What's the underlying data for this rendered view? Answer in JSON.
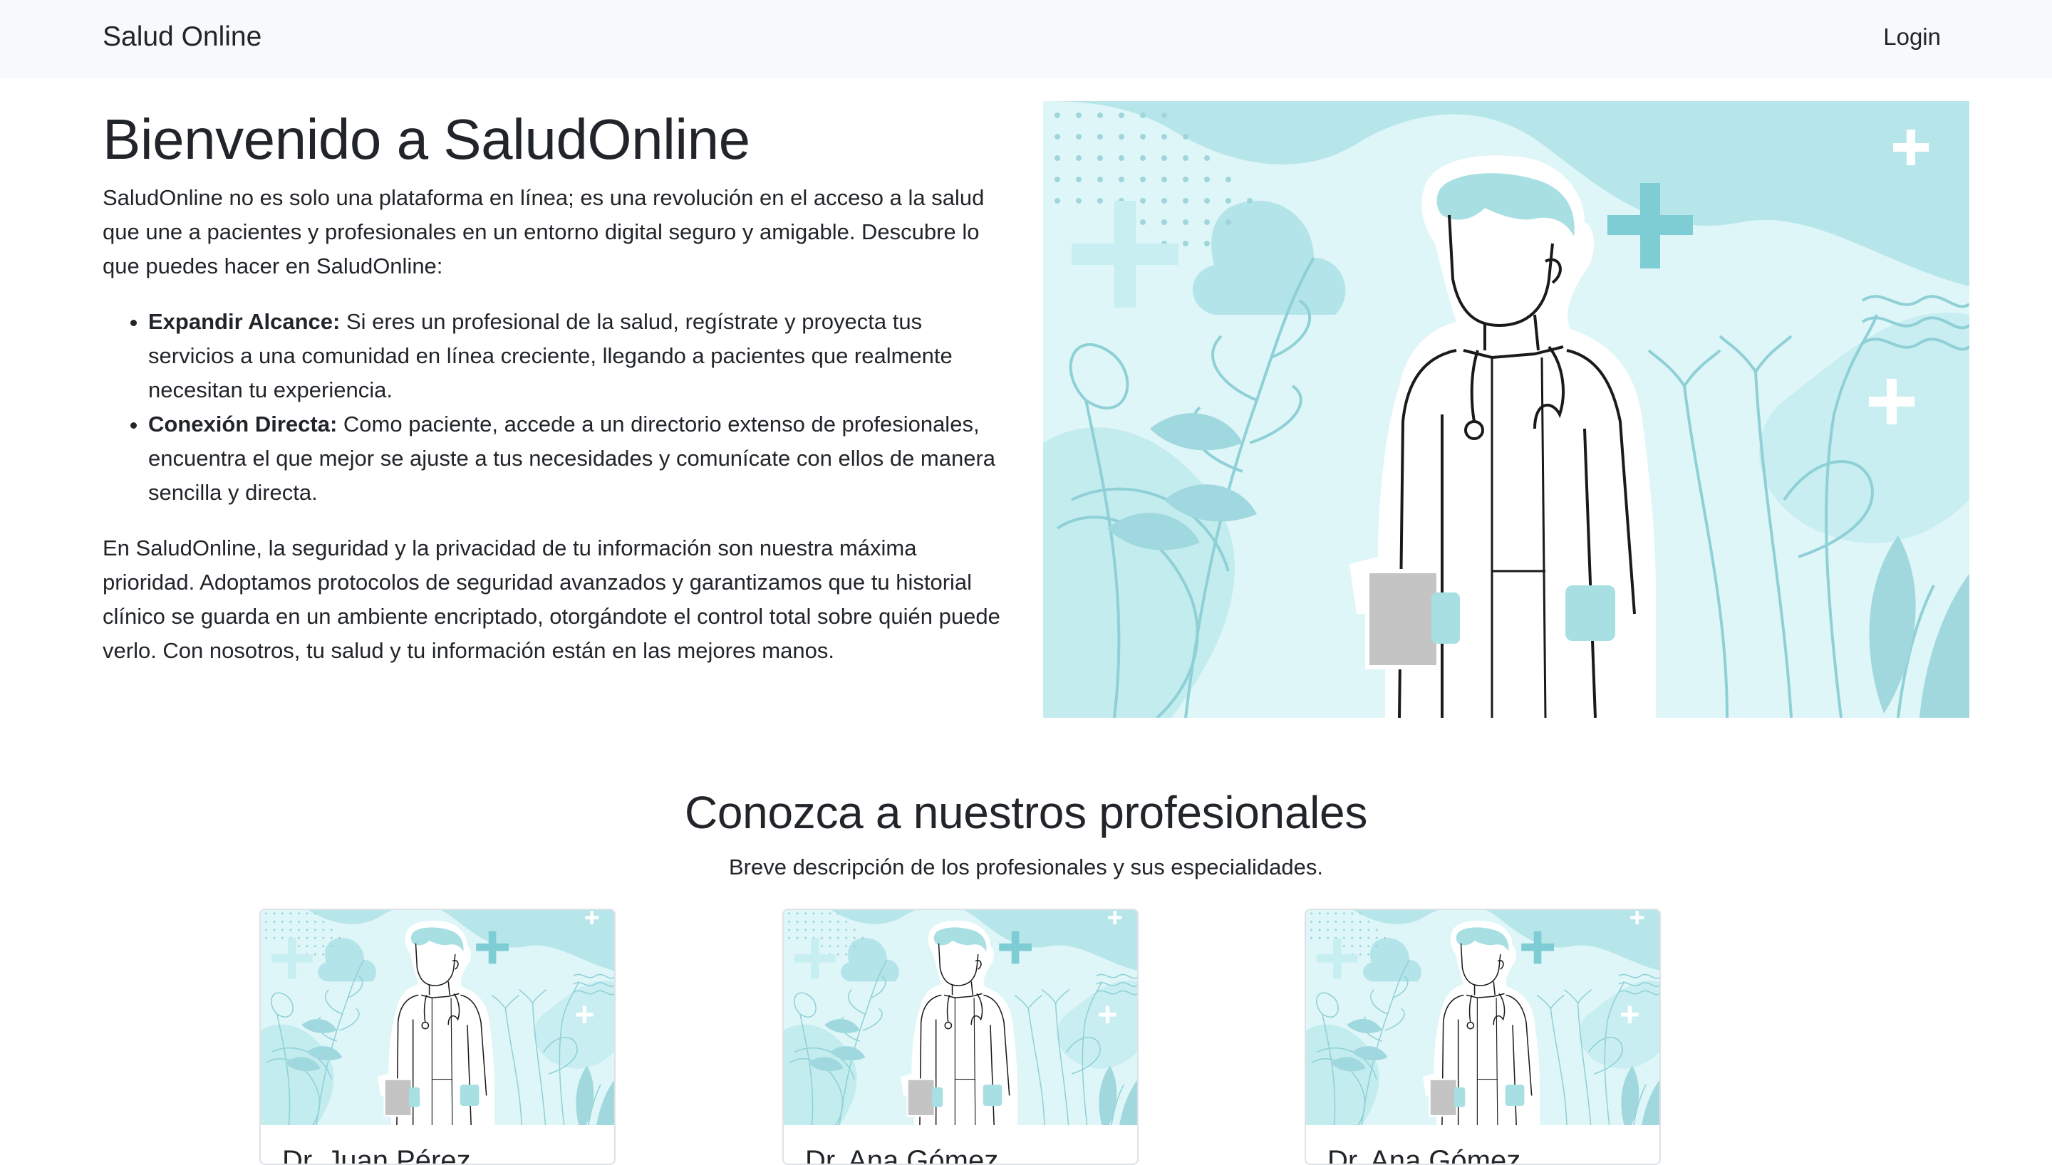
{
  "nav": {
    "brand": "Salud Online",
    "login": "Login"
  },
  "hero": {
    "title": "Bienvenido a SaludOnline",
    "intro": "SaludOnline no es solo una plataforma en línea; es una revolución en el acceso a la salud que une a pacientes y profesionales en un entorno digital seguro y amigable. Descubre lo que puedes hacer en SaludOnline:",
    "features": [
      {
        "title": "Expandir Alcance:",
        "text": " Si eres un profesional de la salud, regístrate y proyecta tus servicios a una comunidad en línea creciente, llegando a pacientes que realmente necesitan tu experiencia."
      },
      {
        "title": "Conexión Directa:",
        "text": " Como paciente, accede a un directorio extenso de profesionales, encuentra el que mejor se ajuste a tus necesidades y comunícate con ellos de manera sencilla y directa."
      }
    ],
    "closing": "En SaludOnline, la seguridad y la privacidad de tu información son nuestra máxima prioridad. Adoptamos protocolos de seguridad avanzados y garantizamos que tu historial clínico se guarda en un ambiente encriptado, otorgándote el control total sobre quién puede verlo. Con nosotros, tu salud y tu información están en las mejores manos."
  },
  "professionals": {
    "title": "Conozca a nuestros profesionales",
    "subtitle": "Breve descripción de los profesionales y sus especialidades.",
    "cards": [
      {
        "name": "Dr. Juan Pérez"
      },
      {
        "name": "Dr. Ana Gómez"
      },
      {
        "name": "Dr. Ana Gómez"
      }
    ]
  },
  "colors": {
    "navbar_bg": "#f8f9fa",
    "text": "#212529",
    "illustration_teal": "#a8dfe3",
    "illustration_light": "#d6f3f5"
  }
}
